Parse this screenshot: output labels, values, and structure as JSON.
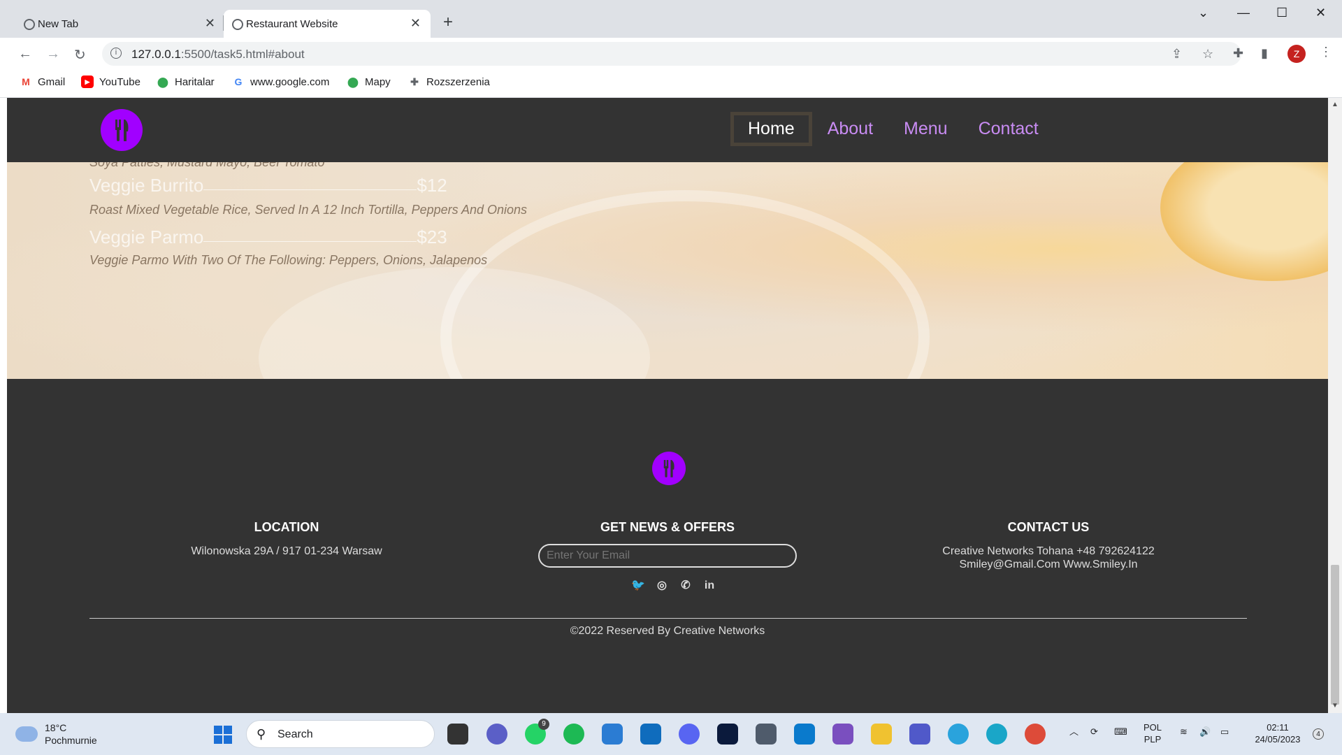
{
  "browser": {
    "tabs": [
      {
        "title": "New Tab"
      },
      {
        "title": "Restaurant Website"
      }
    ],
    "url_host": "127.0.0.1",
    "url_path": ":5500/task5.html#about",
    "profile_initial": "Z",
    "bookmarks": [
      {
        "label": "Gmail",
        "icon": "gmail-icon"
      },
      {
        "label": "YouTube",
        "icon": "youtube-icon"
      },
      {
        "label": "Haritalar",
        "icon": "maps-icon"
      },
      {
        "label": "www.google.com",
        "icon": "google-icon"
      },
      {
        "label": "Mapy",
        "icon": "maps-icon"
      },
      {
        "label": "Rozszerzenia",
        "icon": "puzzle-icon"
      }
    ]
  },
  "site": {
    "nav": [
      {
        "label": "Home",
        "active": true
      },
      {
        "label": "About",
        "active": false
      },
      {
        "label": "Menu",
        "active": false
      },
      {
        "label": "Contact",
        "active": false
      }
    ],
    "menu": {
      "partial_desc": "Soya Patties, Mustard Mayo, Beef Tomato",
      "items": [
        {
          "name": "Veggie Burrito",
          "price": "$12",
          "desc": "Roast Mixed Vegetable Rice, Served In A 12 Inch Tortilla, Peppers And Onions"
        },
        {
          "name": "Veggie Parmo",
          "price": "$23",
          "desc": "Veggie Parmo With Two Of The Following: Peppers, Onions, Jalapenos"
        }
      ]
    },
    "footer": {
      "location_title": "LOCATION",
      "location_text": "Wilonowska 29A / 917 01-234 Warsaw",
      "news_title": "GET NEWS & OFFERS",
      "email_placeholder": "Enter Your Email",
      "contact_title": "CONTACT US",
      "contact_line1": "Creative Networks Tohana +48 792624122",
      "contact_line2": "Smiley@Gmail.Com Www.Smiley.In",
      "copyright": "©2022 Reserved By Creative Networks",
      "socials": [
        "twitter-icon",
        "instagram-icon",
        "whatsapp-icon",
        "linkedin-icon"
      ]
    },
    "accent_color": "#a100ff",
    "link_color": "#c98cf3"
  },
  "taskbar": {
    "weather_temp": "18°C",
    "weather_desc": "Pochmurnie",
    "search_label": "Search",
    "whatsapp_badge": "9",
    "lang_line1": "POL",
    "lang_line2": "PLP",
    "time": "02:11",
    "date": "24/05/2023",
    "notifications": "4"
  }
}
